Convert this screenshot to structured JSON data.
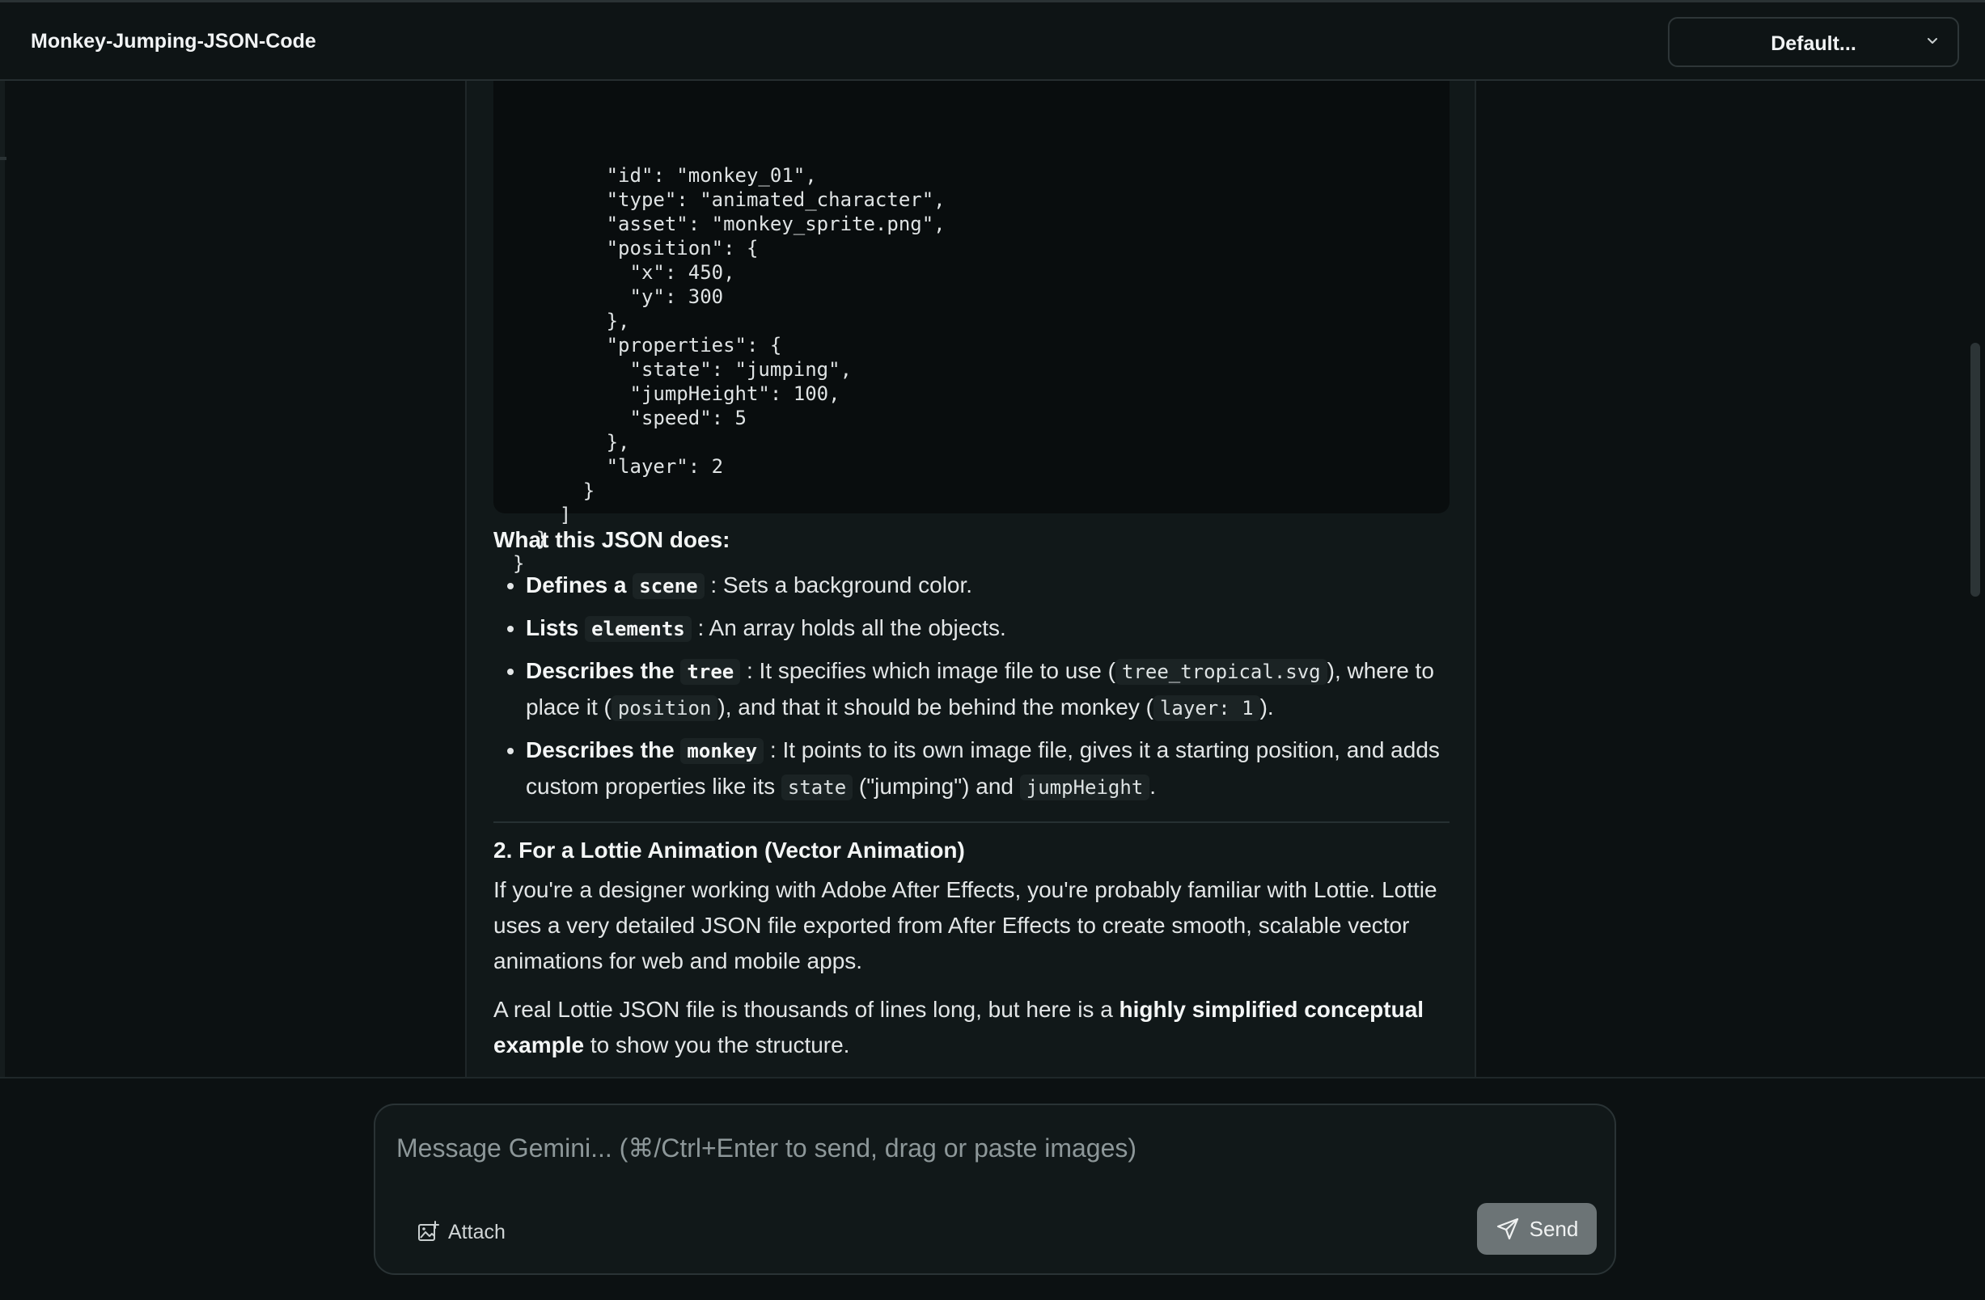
{
  "header": {
    "title": "Monkey-Jumping-JSON-Code",
    "model_select": "Default..."
  },
  "code_block": {
    "lines": [
      "    \"id\": \"monkey_01\",",
      "    \"type\": \"animated_character\",",
      "    \"asset\": \"monkey_sprite.png\",",
      "    \"position\": {",
      "      \"x\": 450,",
      "      \"y\": 300",
      "    },",
      "    \"properties\": {",
      "      \"state\": \"jumping\",",
      "      \"jumpHeight\": 100,",
      "      \"speed\": 5",
      "    },",
      "    \"layer\": 2",
      "  }",
      " ]",
      "}",
      "}"
    ]
  },
  "content": {
    "what_heading": "What this JSON does:",
    "bullets": [
      {
        "lead": "Defines a",
        "code": "scene",
        "rest": ": Sets a background color."
      },
      {
        "lead": "Lists",
        "code": "elements",
        "rest": ": An array holds all the objects."
      },
      {
        "lead": "Describes the",
        "code": "tree",
        "rest_a": ": It specifies which image file to use (",
        "code_a": "tree_tropical.svg",
        "rest_b": "), where to place it (",
        "code_b": "position",
        "rest_c": "), and that it should be behind the monkey (",
        "code_c": "layer: 1",
        "rest_d": ")."
      },
      {
        "lead": "Describes the",
        "code": "monkey",
        "rest_a": ": It points to its own image file, gives it a starting position, and adds custom properties like its",
        "code_a": "state",
        "rest_b": "(\"jumping\") and",
        "code_b": "jumpHeight",
        "rest_c": "."
      }
    ],
    "section_heading": "2. For a Lottie Animation (Vector Animation)",
    "para1": "If you're a designer working with Adobe After Effects, you're probably familiar with Lottie. Lottie uses a very detailed JSON file exported from After Effects to create smooth, scalable vector animations for web and mobile apps.",
    "para2_a": "A real Lottie JSON file is thousands of lines long, but here is a",
    "para2_bold": "highly simplified conceptual example",
    "para2_b": "to show you the structure."
  },
  "composer": {
    "placeholder": "Message Gemini... (⌘/Ctrl+Enter to send, drag or paste images)",
    "attach_label": "Attach",
    "send_label": "Send"
  },
  "icons": {
    "attach": "image-add-icon",
    "send": "paper-plane-icon",
    "model_chevron": "chevron-down-icon"
  }
}
